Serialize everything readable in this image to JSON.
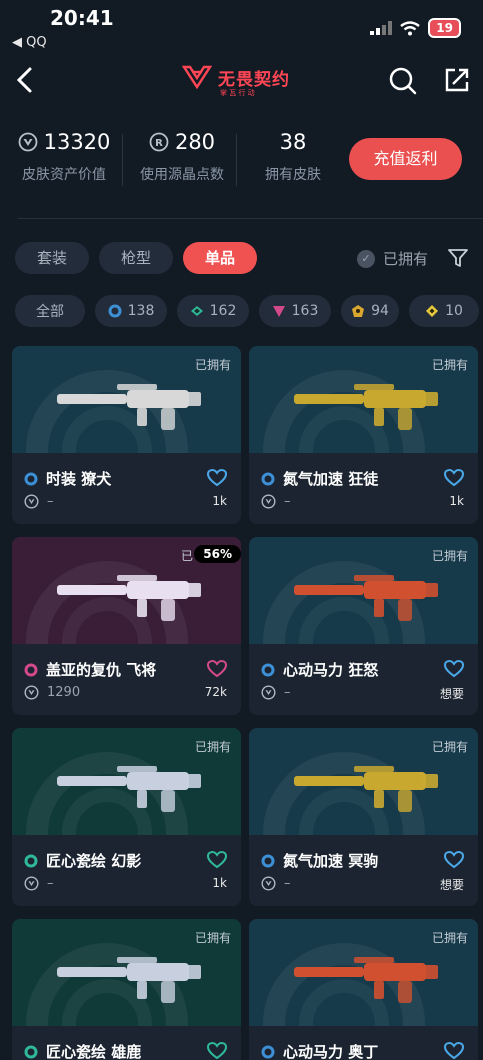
{
  "status": {
    "time": "20:41",
    "back_app": "◀ QQ",
    "battery": "19"
  },
  "nav": {
    "logo_text": "无畏契约",
    "logo_sub": "掌 瓦 行 动"
  },
  "stats": [
    {
      "value": "13320",
      "label": "皮肤资产价值",
      "icon": "vp-icon"
    },
    {
      "value": "280",
      "label": "使用源晶点数",
      "icon": "radianite-icon"
    },
    {
      "value": "38",
      "label": "拥有皮肤",
      "icon": ""
    }
  ],
  "recharge_label": "充值返利",
  "tabs": [
    {
      "label": "套装",
      "active": false
    },
    {
      "label": "枪型",
      "active": false
    },
    {
      "label": "单品",
      "active": true
    }
  ],
  "owned_filter_label": "已拥有",
  "chips": [
    {
      "label": "全部",
      "tier": null
    },
    {
      "label": "138",
      "tier": "select",
      "color": "#3d8fd6"
    },
    {
      "label": "162",
      "tier": "deluxe",
      "color": "#2fb89a"
    },
    {
      "label": "163",
      "tier": "premium",
      "color": "#d4498a"
    },
    {
      "label": "94",
      "tier": "exclusive",
      "color": "#d9a630"
    },
    {
      "label": "10",
      "tier": "ultra",
      "color": "#e8c93a"
    }
  ],
  "cards": [
    {
      "name": "时装 獠犬",
      "tier_color": "#3d8fd6",
      "price": "–",
      "likes": "1k",
      "owned_label": "已拥有",
      "bg": "#163a4a",
      "heart_color": "#4aa8e8",
      "gun_color": "#d8d8d8"
    },
    {
      "name": "氮气加速 狂徒",
      "tier_color": "#3d8fd6",
      "price": "–",
      "likes": "1k",
      "owned_label": "已拥有",
      "bg": "#163a4a",
      "heart_color": "#4aa8e8",
      "gun_color": "#c9a830"
    },
    {
      "name": "盖亚的复仇 飞将",
      "tier_color": "#d4498a",
      "price": "1290",
      "likes": "72k",
      "owned_label": "已",
      "percent": "56%",
      "bg": "#3a1e38",
      "heart_color": "#d4498a",
      "gun_color": "#e8e0f0"
    },
    {
      "name": "心动马力 狂怒",
      "tier_color": "#3d8fd6",
      "price": "–",
      "likes": "想要",
      "owned_label": "已拥有",
      "bg": "#163a4a",
      "heart_color": "#4aa8e8",
      "gun_color": "#d05030"
    },
    {
      "name": "匠心瓷绘 幻影",
      "tier_color": "#2fb89a",
      "price": "–",
      "likes": "1k",
      "owned_label": "已拥有",
      "bg": "#103a38",
      "heart_color": "#2fb89a",
      "gun_color": "#c8d0e0"
    },
    {
      "name": "氮气加速 冥驹",
      "tier_color": "#3d8fd6",
      "price": "–",
      "likes": "想要",
      "owned_label": "已拥有",
      "bg": "#163a4a",
      "heart_color": "#4aa8e8",
      "gun_color": "#c9a830"
    },
    {
      "name": "匠心瓷绘 雄鹿",
      "tier_color": "#2fb89a",
      "price": "–",
      "likes": "",
      "owned_label": "已拥有",
      "bg": "#103a38",
      "heart_color": "#2fb89a",
      "gun_color": "#c8d0e0"
    },
    {
      "name": "心动马力 奥丁",
      "tier_color": "#3d8fd6",
      "price": "–",
      "likes": "",
      "owned_label": "已拥有",
      "bg": "#163a4a",
      "heart_color": "#4aa8e8",
      "gun_color": "#d05030"
    }
  ]
}
